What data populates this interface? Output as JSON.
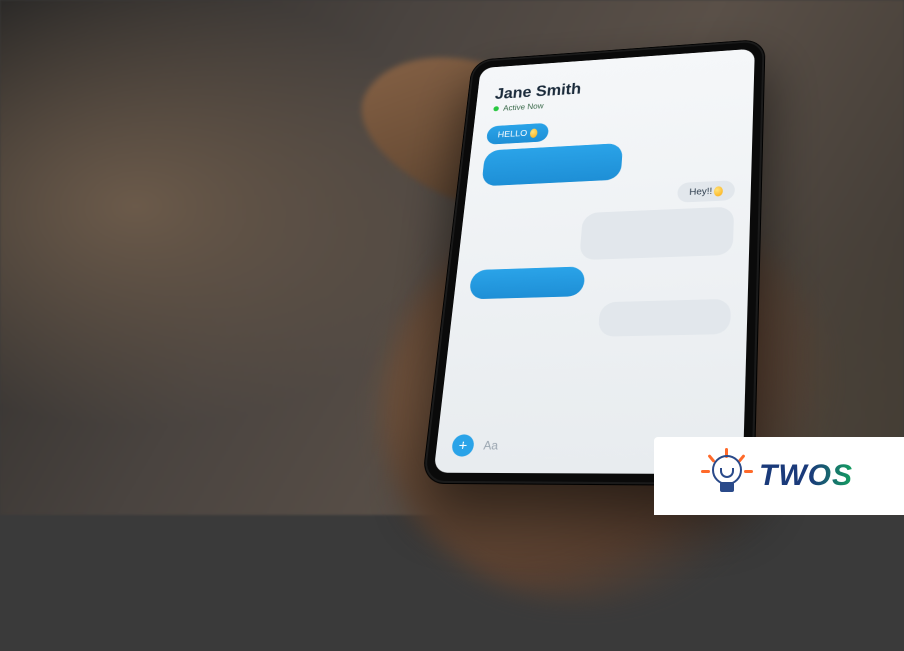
{
  "chat": {
    "contact_name": "Jane Smith",
    "status_text": "Active Now",
    "messages": [
      {
        "side": "sent",
        "text": "HELLO",
        "has_emoji": true
      },
      {
        "side": "sent",
        "text": ""
      },
      {
        "side": "recv",
        "text": "Hey!!",
        "has_emoji": true
      },
      {
        "side": "recv",
        "text": ""
      },
      {
        "side": "sent",
        "text": ""
      },
      {
        "side": "recv",
        "text": ""
      }
    ],
    "input_placeholder": "Aa",
    "add_button_glyph": "+"
  },
  "watermark": {
    "brand_text": "TWOS",
    "icon_name": "lightbulb-icon"
  }
}
